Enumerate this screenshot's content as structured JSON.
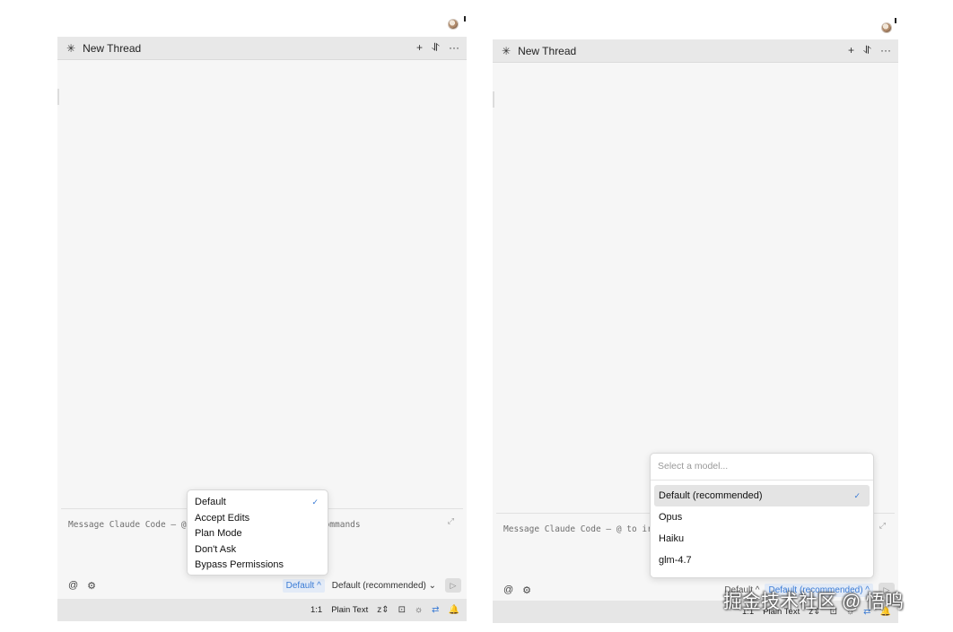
{
  "left": {
    "header": {
      "thread_icon": "✳",
      "title": "New Thread",
      "new_label": "+",
      "menu_label": "⥯",
      "more_label": "···"
    },
    "compose": {
      "placeholder_left": "Message Claude Code — @",
      "placeholder_right": "ommands",
      "expand_icon": "⤢"
    },
    "bottom": {
      "at": "@",
      "gear": "⚙",
      "mode": "Default ^",
      "model": "Default (recommended) ⌄",
      "send": "▷"
    },
    "status": {
      "ratio": "1:1",
      "language": "Plain Text",
      "i1": "z⇕",
      "i2": "⊡",
      "i3": "☼",
      "i4": "⇄",
      "i5": "🔔"
    },
    "mode_menu": {
      "items": [
        "Default",
        "Accept Edits",
        "Plan Mode",
        "Don't Ask",
        "Bypass Permissions"
      ],
      "check": "✓"
    }
  },
  "right": {
    "header": {
      "thread_icon": "✳",
      "title": "New Thread",
      "new_label": "+",
      "menu_label": "⥯",
      "more_label": "···"
    },
    "compose": {
      "placeholder": "Message Claude Code — @ to ir",
      "expand_icon": "⤢"
    },
    "bottom": {
      "at": "@",
      "gear": "⚙",
      "mode": "Default ^",
      "model": "Default (recommended) ^",
      "send": "▷"
    },
    "status": {
      "ratio": "1:1",
      "language": "Plain Text",
      "i1": "z⇕",
      "i2": "⊡",
      "i3": "☼",
      "i4": "⇄",
      "i5": "🔔"
    },
    "model_menu": {
      "placeholder": "Select a model...",
      "items": [
        "Default (recommended)",
        "Opus",
        "Haiku",
        "glm-4.7"
      ],
      "check": "✓"
    }
  },
  "watermark": "掘金技术社区 @ 悟鸣",
  "colors": {
    "accent": "#3a7bd5",
    "panel": "#f6f6f6",
    "header": "#e8e8e8"
  }
}
